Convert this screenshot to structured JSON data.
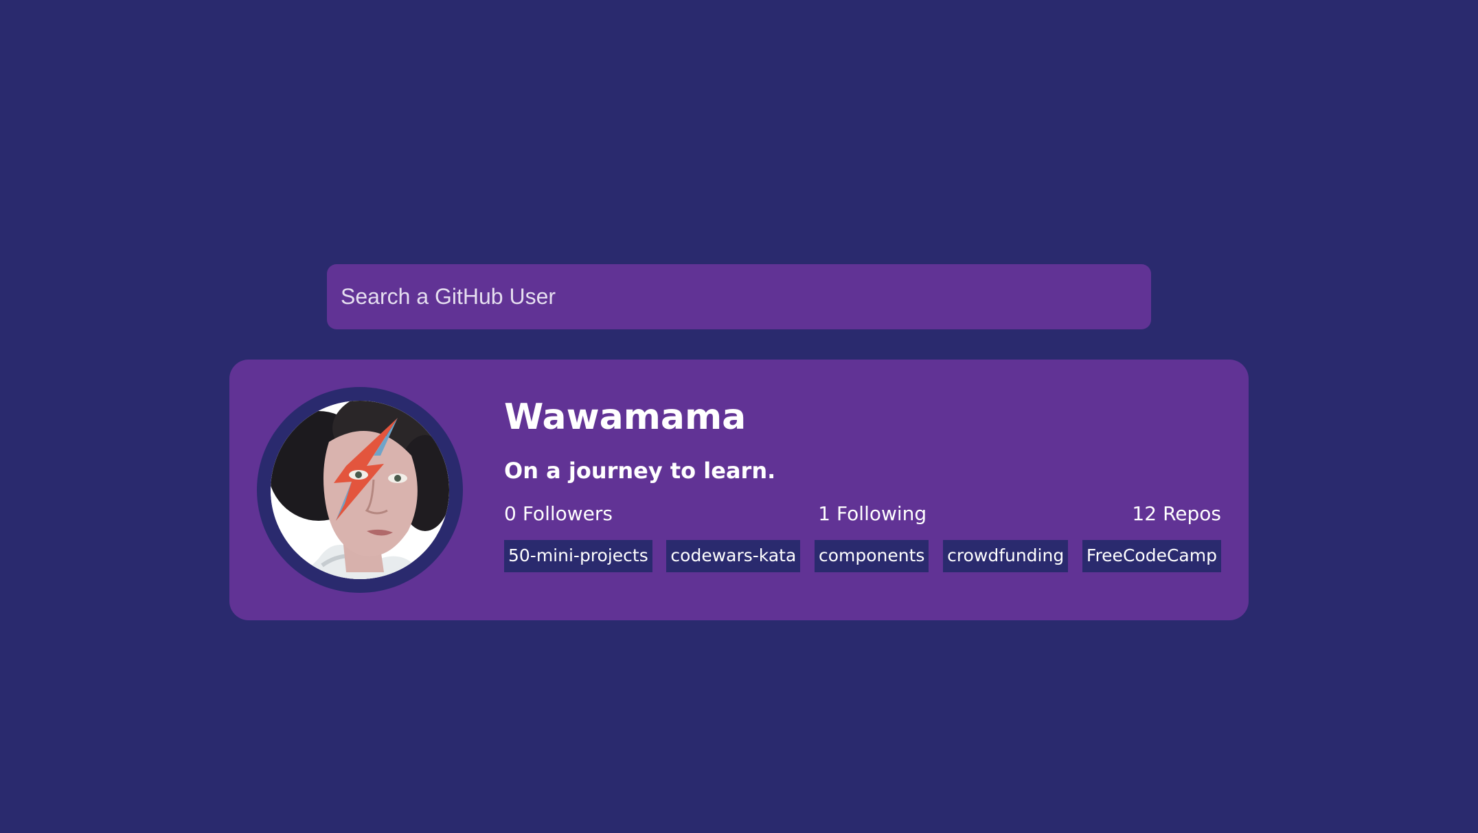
{
  "search": {
    "placeholder": "Search a GitHub User"
  },
  "profile": {
    "name": "Wawamama",
    "bio": "On a journey to learn.",
    "avatar_alt": "Avatar illustration",
    "stats": {
      "followers_count": "0",
      "followers_label": "Followers",
      "following_count": "1",
      "following_label": "Following",
      "repos_count": "12",
      "repos_label": "Repos"
    },
    "repos": [
      {
        "name": "50-mini-projects"
      },
      {
        "name": "codewars-kata"
      },
      {
        "name": "components"
      },
      {
        "name": "crowdfunding"
      },
      {
        "name": "FreeCodeCamp"
      }
    ]
  },
  "colors": {
    "background": "#2a2a6e",
    "card": "#613395",
    "tag": "#2a2a6e",
    "text": "#ffffff"
  },
  "icons": {
    "avatar": "avatar-portrait-icon"
  }
}
